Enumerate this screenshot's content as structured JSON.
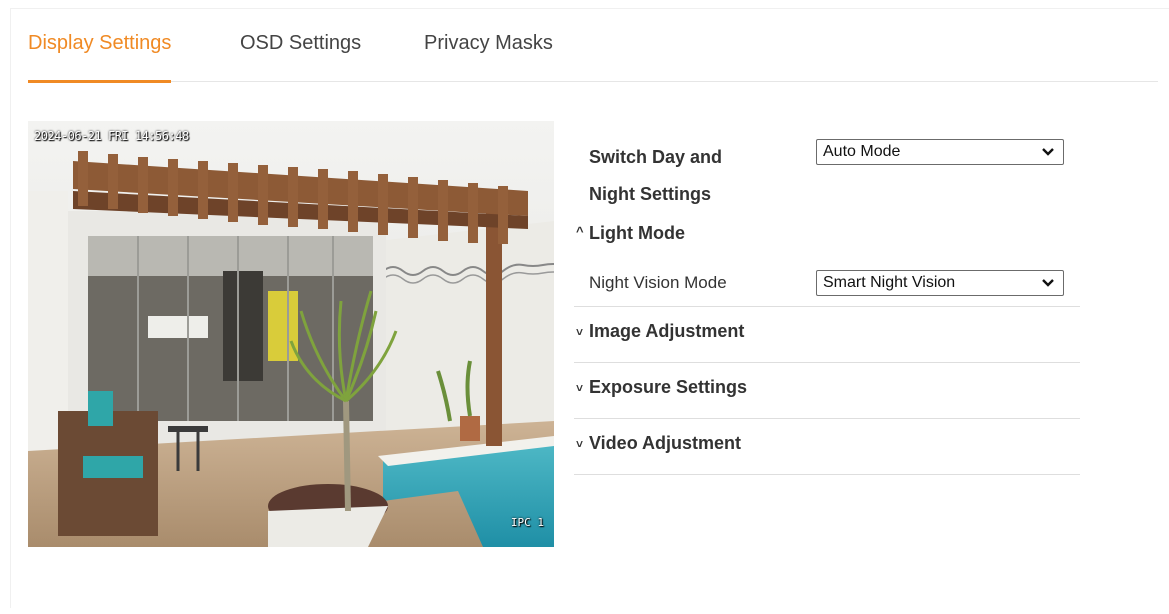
{
  "tabs": [
    {
      "label": "Display Settings",
      "active": true
    },
    {
      "label": "OSD Settings",
      "active": false
    },
    {
      "label": "Privacy Masks",
      "active": false
    }
  ],
  "preview": {
    "timestamp": "2024-06-21 FRI 14:56:48",
    "camera_name": "IPC 1"
  },
  "settings": {
    "day_night": {
      "label_line1": "Switch Day and",
      "label_line2": "Night Settings",
      "value": "Auto Mode"
    },
    "light_mode": {
      "title": "Light Mode",
      "caret": "^",
      "night_vision_label": "Night Vision Mode",
      "night_vision_value": "Smart Night Vision"
    },
    "sections": [
      {
        "title": "Image Adjustment",
        "caret": "˅"
      },
      {
        "title": "Exposure Settings",
        "caret": "˅"
      },
      {
        "title": "Video Adjustment",
        "caret": "˅"
      }
    ]
  },
  "colors": {
    "accent": "#f08a24"
  }
}
